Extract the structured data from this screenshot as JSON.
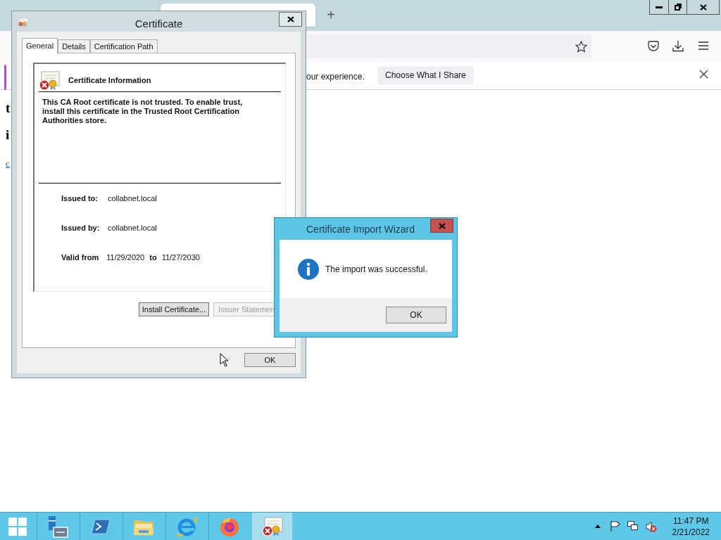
{
  "browser": {
    "new_tab_button": "+",
    "notification": {
      "message": "our experience.",
      "button": "Choose What I Share"
    },
    "page_texts": [
      {
        "kind": "heading",
        "text": "t"
      },
      {
        "kind": "heading",
        "text": "i"
      },
      {
        "kind": "link",
        "text": "c"
      }
    ]
  },
  "certificate_dialog": {
    "title": "Certificate",
    "tabs": [
      {
        "label": "General",
        "selected": true
      },
      {
        "label": "Details",
        "selected": false
      },
      {
        "label": "Certification Path",
        "selected": false
      }
    ],
    "info_title": "Certificate Information",
    "message": "This CA Root certificate is not trusted. To enable trust, install this certificate in the Trusted Root Certification Authorities store.",
    "fields": [
      {
        "label": "Issued to:",
        "value": "collabnet.local"
      },
      {
        "label": "Issued by:",
        "value": "collabnet.local"
      }
    ],
    "validity": {
      "label": "Valid from",
      "from": "11/29/2020",
      "to_label": "to",
      "to": "11/27/2030"
    },
    "buttons": [
      {
        "label": "Install Certificate...",
        "disabled": false
      },
      {
        "label": "Issuer Statemen",
        "disabled": true
      }
    ],
    "ok": "OK"
  },
  "wizard": {
    "title": "Certificate Import Wizard",
    "message": "The import was successful.",
    "ok": "OK"
  },
  "taskbar": {
    "apps": [
      {
        "kind": "server-manager",
        "active": false
      },
      {
        "kind": "powershell",
        "active": false
      },
      {
        "kind": "explorer",
        "active": false
      },
      {
        "kind": "ie",
        "active": false
      },
      {
        "kind": "firefox",
        "active": false
      },
      {
        "kind": "certificate",
        "active": true
      }
    ],
    "clock": {
      "time": "11:47 PM",
      "date": "2/21/2022"
    }
  }
}
